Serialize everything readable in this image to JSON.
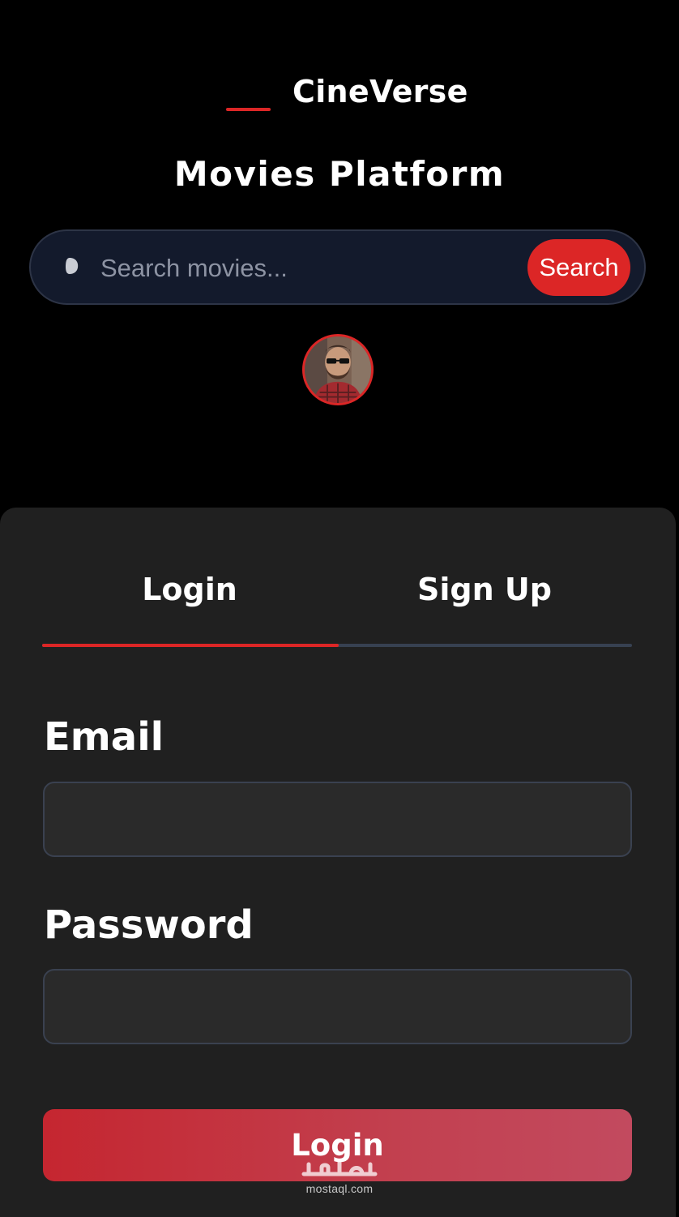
{
  "brand": {
    "name": "CineVerse"
  },
  "platform_title": "Movies Platform",
  "search": {
    "placeholder": "Search movies...",
    "value": "",
    "button_label": "Search"
  },
  "icons": {
    "search": "search-icon",
    "avatar": "user-avatar"
  },
  "auth": {
    "tabs": [
      {
        "label": "Login",
        "active": true
      },
      {
        "label": "Sign Up",
        "active": false
      }
    ],
    "fields": {
      "email_label": "Email",
      "email_value": "",
      "password_label": "Password",
      "password_value": ""
    },
    "submit_label": "Login"
  },
  "watermark": {
    "mark": "مستقل",
    "site": "mostaql.com"
  },
  "colors": {
    "accent": "#dc2626",
    "background": "#000000",
    "panel": "#202020",
    "search_bar": "#131a2c",
    "input_bg": "#2a2a2a",
    "tab_track": "#374151"
  }
}
